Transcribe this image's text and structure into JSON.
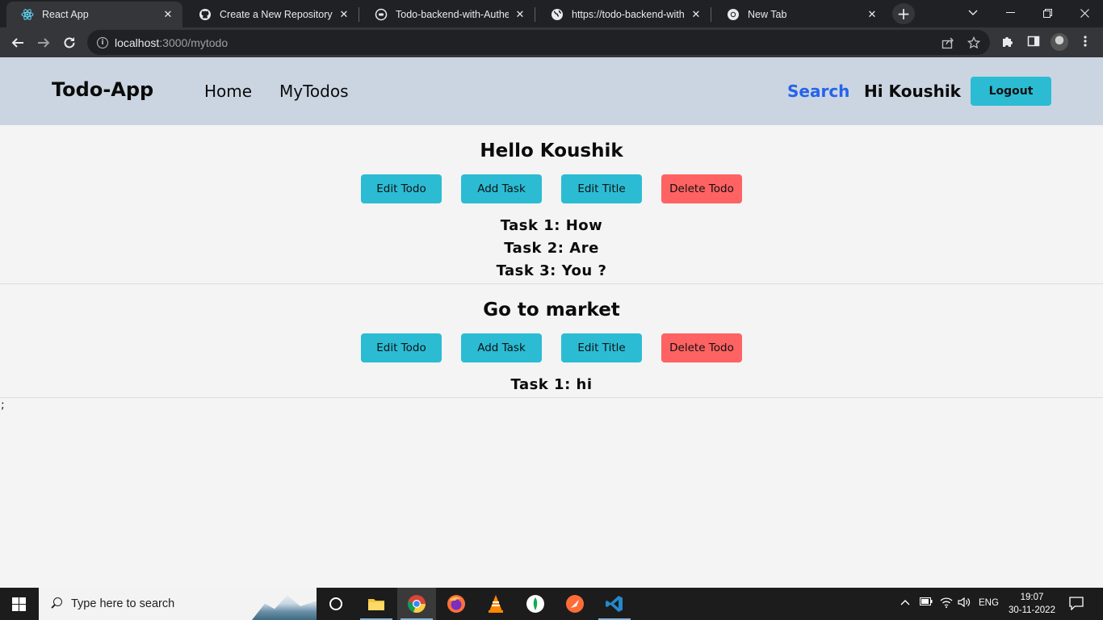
{
  "browser": {
    "tabs": [
      {
        "title": "React App",
        "icon": "react-icon",
        "active": true
      },
      {
        "title": "Create a New Repository",
        "icon": "github-icon",
        "active": false
      },
      {
        "title": "Todo-backend-with-Authenti",
        "icon": "api-icon",
        "active": false
      },
      {
        "title": "https://todo-backend-with-a",
        "icon": "globe-icon",
        "active": false
      },
      {
        "title": "New Tab",
        "icon": "chrome-icon",
        "active": false
      }
    ],
    "close_glyph": "✕",
    "new_tab_glyph": "+",
    "url_host": "localhost",
    "url_path": ":3000/mytodo"
  },
  "navbar": {
    "brand": "Todo-App",
    "links": [
      "Home",
      "MyTodos"
    ],
    "search": "Search",
    "greeting": "Hi Koushik",
    "logout": "Logout"
  },
  "todos": [
    {
      "title": "Hello Koushik",
      "buttons": {
        "edit_todo": "Edit Todo",
        "add_task": "Add Task",
        "edit_title": "Edit Title",
        "delete_todo": "Delete Todo"
      },
      "tasks": [
        "Task 1: How",
        "Task 2: Are",
        "Task 3: You ?"
      ]
    },
    {
      "title": "Go to market",
      "buttons": {
        "edit_todo": "Edit Todo",
        "add_task": "Add Task",
        "edit_title": "Edit Title",
        "delete_todo": "Delete Todo"
      },
      "tasks": [
        "Task 1: hi"
      ]
    }
  ],
  "stray_text": ";",
  "taskbar": {
    "search_placeholder": "Type here to search",
    "language": "ENG",
    "time": "19:07",
    "date": "30-11-2022"
  },
  "colors": {
    "navbar_bg": "#cbd5e1",
    "teal_button": "#2bbcd4",
    "red_button": "#ff6262",
    "search_link": "#2563eb"
  }
}
